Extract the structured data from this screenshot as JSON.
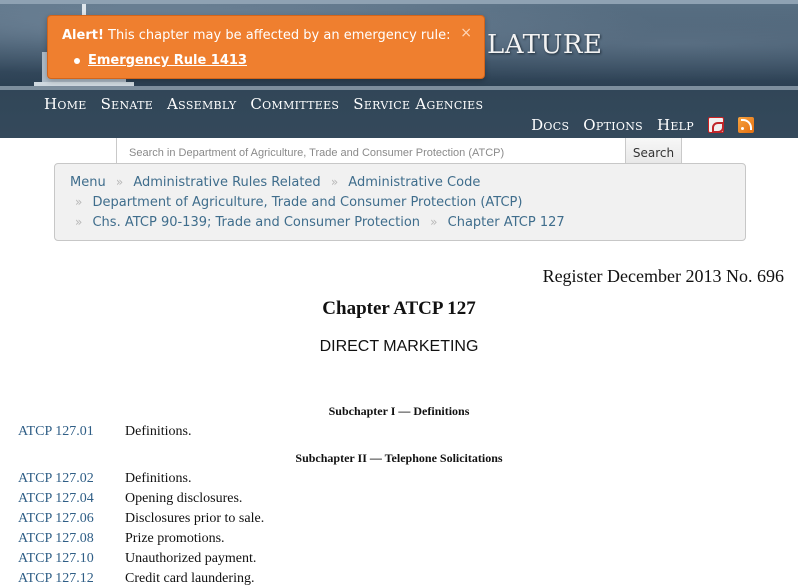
{
  "header": {
    "banner_title": "LATURE",
    "nav_primary": [
      "Home",
      "Senate",
      "Assembly",
      "Committees",
      "Service Agencies"
    ],
    "nav_secondary": [
      "Docs",
      "Options",
      "Help"
    ],
    "icons": [
      "pdf-icon",
      "rss-icon"
    ]
  },
  "alert": {
    "label": "Alert!",
    "message": " This chapter may be affected by an emergency rule:",
    "close": "×",
    "link": "Emergency Rule 1413",
    "color": "#ef7f2f"
  },
  "search": {
    "placeholder": "Search in Department of Agriculture, Trade and Consumer Protection (ATCP)",
    "button": "Search"
  },
  "breadcrumb": {
    "row1": [
      "Menu",
      "Administrative Rules Related",
      "Administrative Code"
    ],
    "row2": [
      "Department of Agriculture, Trade and Consumer Protection (ATCP)"
    ],
    "row3": [
      "Chs. ATCP 90-139; Trade and Consumer Protection",
      "Chapter ATCP 127"
    ],
    "separator": "»"
  },
  "document": {
    "register": "Register December 2013 No. 696",
    "chapter_title": "Chapter ATCP 127",
    "chapter_subtitle": "DIRECT MARKETING",
    "subchapter_1": "Subchapter I — Definitions",
    "subchapter_2": "Subchapter II — Telephone Solicitations",
    "sub1_items": [
      {
        "num": "ATCP 127.01",
        "desc": "Definitions."
      }
    ],
    "sub2_items": [
      {
        "num": "ATCP 127.02",
        "desc": "Definitions."
      },
      {
        "num": "ATCP 127.04",
        "desc": "Opening disclosures."
      },
      {
        "num": "ATCP 127.06",
        "desc": "Disclosures prior to sale."
      },
      {
        "num": "ATCP 127.08",
        "desc": "Prize promotions."
      },
      {
        "num": "ATCP 127.10",
        "desc": "Unauthorized payment."
      },
      {
        "num": "ATCP 127.12",
        "desc": "Credit card laundering."
      }
    ]
  }
}
